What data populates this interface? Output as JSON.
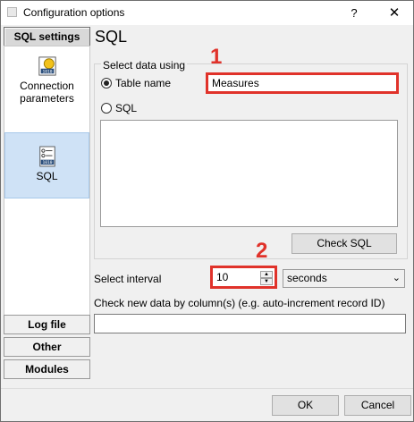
{
  "window": {
    "title": "Configuration options",
    "help_label": "?",
    "close_label": "✕"
  },
  "sidebar": {
    "active_tab": "SQL settings",
    "nav_items": [
      {
        "label": "Connection parameters",
        "icon": "connection-parameters-icon"
      },
      {
        "label": "SQL",
        "icon": "sql-form-icon",
        "selected": true
      }
    ],
    "bottom_tabs": [
      "Log file",
      "Other",
      "Modules"
    ]
  },
  "main": {
    "title": "SQL",
    "select_group_label": "Select data using",
    "table_name_label": "Table name",
    "table_name_value": "Measures",
    "sql_label": "SQL",
    "sql_text": "",
    "check_sql_label": "Check SQL",
    "select_interval_label": "Select interval",
    "interval_value": "10",
    "interval_unit": "seconds",
    "check_column_label": "Check new data by column(s) (e.g. auto-increment record ID)",
    "check_column_value": "",
    "annotations": [
      "1",
      "2"
    ]
  },
  "footer": {
    "ok_label": "OK",
    "cancel_label": "Cancel"
  },
  "colors": {
    "highlight": "#e0322a",
    "selected_nav": "#cfe2f6"
  }
}
